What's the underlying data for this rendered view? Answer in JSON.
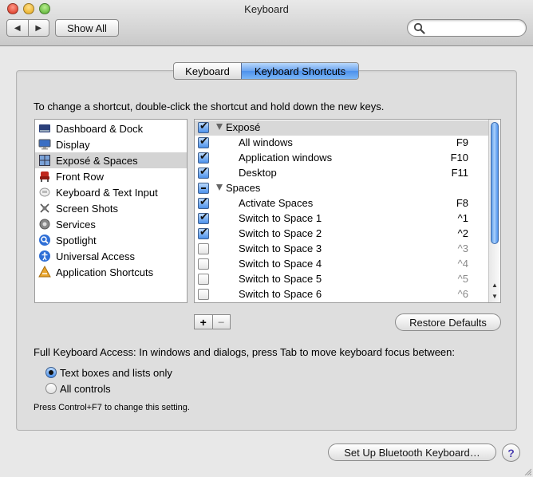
{
  "window": {
    "title": "Keyboard"
  },
  "toolbar": {
    "back_glyph": "◀",
    "forward_glyph": "▶",
    "show_all_label": "Show All",
    "search": {
      "value": "",
      "placeholder": ""
    }
  },
  "tabs": [
    {
      "label": "Keyboard",
      "selected": false
    },
    {
      "label": "Keyboard Shortcuts",
      "selected": true
    }
  ],
  "instructions": "To change a shortcut, double-click the shortcut and hold down the new keys.",
  "categories": [
    {
      "label": "Dashboard & Dock",
      "icon": "dashboard-icon",
      "selected": false
    },
    {
      "label": "Display",
      "icon": "display-icon",
      "selected": false
    },
    {
      "label": "Exposé & Spaces",
      "icon": "spaces-icon",
      "selected": true
    },
    {
      "label": "Front Row",
      "icon": "front-row-icon",
      "selected": false
    },
    {
      "label": "Keyboard & Text Input",
      "icon": "keyboard-icon",
      "selected": false
    },
    {
      "label": "Screen Shots",
      "icon": "camera-icon",
      "selected": false
    },
    {
      "label": "Services",
      "icon": "gear-icon",
      "selected": false
    },
    {
      "label": "Spotlight",
      "icon": "spotlight-icon",
      "selected": false
    },
    {
      "label": "Universal Access",
      "icon": "accessibility-icon",
      "selected": false
    },
    {
      "label": "Application Shortcuts",
      "icon": "app-shortcuts-icon",
      "selected": false
    }
  ],
  "shortcuts": [
    {
      "type": "group",
      "label": "Exposé",
      "state": "on",
      "key": ""
    },
    {
      "type": "item",
      "label": "All windows",
      "state": "on",
      "key": "F9"
    },
    {
      "type": "item",
      "label": "Application windows",
      "state": "on",
      "key": "F10"
    },
    {
      "type": "item",
      "label": "Desktop",
      "state": "on",
      "key": "F11"
    },
    {
      "type": "group",
      "label": "Spaces",
      "state": "mixed",
      "key": ""
    },
    {
      "type": "item",
      "label": "Activate Spaces",
      "state": "on",
      "key": "F8"
    },
    {
      "type": "item",
      "label": "Switch to Space 1",
      "state": "on",
      "key": "^1"
    },
    {
      "type": "item",
      "label": "Switch to Space 2",
      "state": "on",
      "key": "^2"
    },
    {
      "type": "item",
      "label": "Switch to Space 3",
      "state": "off",
      "key": "^3"
    },
    {
      "type": "item",
      "label": "Switch to Space 4",
      "state": "off",
      "key": "^4"
    },
    {
      "type": "item",
      "label": "Switch to Space 5",
      "state": "off",
      "key": "^5"
    },
    {
      "type": "item",
      "label": "Switch to Space 6",
      "state": "off",
      "key": "^6"
    }
  ],
  "list_buttons": {
    "add": "+",
    "remove": "−"
  },
  "restore_label": "Restore Defaults",
  "full_keyboard_access": {
    "label": "Full Keyboard Access: In windows and dialogs, press Tab to move keyboard focus between:",
    "options": [
      {
        "label": "Text boxes and lists only",
        "selected": true
      },
      {
        "label": "All controls",
        "selected": false
      }
    ],
    "hint": "Press Control+F7 to change this setting."
  },
  "bluetooth_label": "Set Up Bluetooth Keyboard…",
  "help_label": "?",
  "colors": {
    "accent": "#4d91ec",
    "selection": "#d4d4d4",
    "dim_key": "#888888"
  }
}
